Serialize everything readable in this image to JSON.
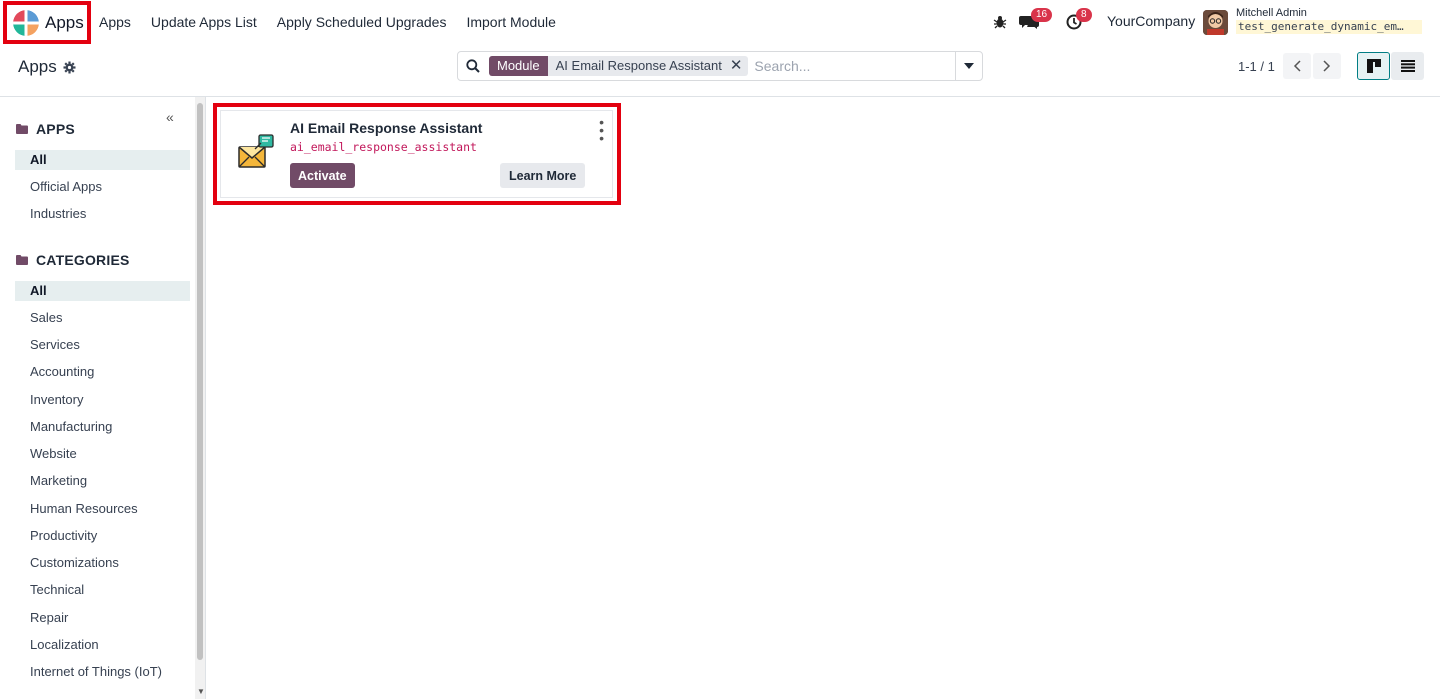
{
  "navbar": {
    "brand": "Apps",
    "menu": [
      "Apps",
      "Update Apps List",
      "Apply Scheduled Upgrades",
      "Import Module"
    ],
    "messages_count": "16",
    "activities_count": "8",
    "company": "YourCompany",
    "user_name": "Mitchell Admin",
    "database": "test_generate_dynamic_em…"
  },
  "control": {
    "title": "Apps",
    "facet_label": "Module",
    "facet_value": "AI Email Response Assistant",
    "search_placeholder": "Search...",
    "pager": "1-1 / 1"
  },
  "sidebar": {
    "apps_header": "APPS",
    "apps": [
      "All",
      "Official Apps",
      "Industries"
    ],
    "categories_header": "CATEGORIES",
    "categories": [
      "All",
      "Sales",
      "Services",
      "Accounting",
      "Inventory",
      "Manufacturing",
      "Website",
      "Marketing",
      "Human Resources",
      "Productivity",
      "Customizations",
      "Technical",
      "Repair",
      "Localization",
      "Internet of Things (IoT)"
    ]
  },
  "card": {
    "title": "AI Email Response Assistant",
    "technical_name": "ai_email_response_assistant",
    "activate_label": "Activate",
    "learn_more_label": "Learn More"
  },
  "colors": {
    "primary": "#714b67",
    "highlight": "#e3000f",
    "badge": "#d9344a"
  }
}
